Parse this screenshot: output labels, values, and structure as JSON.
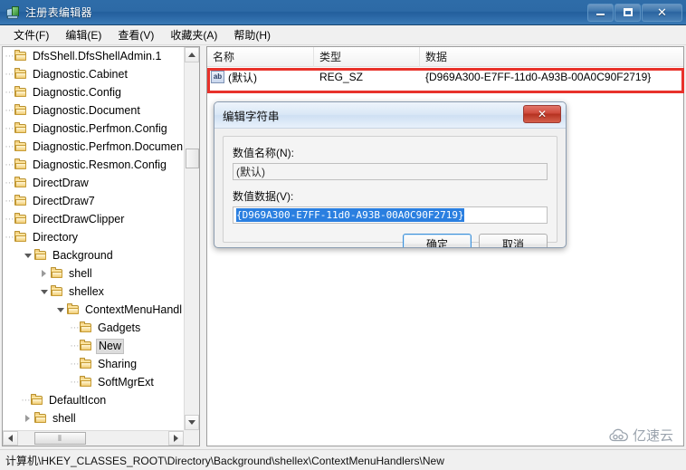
{
  "window": {
    "title": "注册表编辑器",
    "icon": "registry-editor-icon",
    "buttons": {
      "minimize": "minimize-icon",
      "maximize": "maximize-icon",
      "close": "close-icon"
    }
  },
  "menubar": {
    "items": [
      {
        "label": "文件(F)"
      },
      {
        "label": "编辑(E)"
      },
      {
        "label": "查看(V)"
      },
      {
        "label": "收藏夹(A)"
      },
      {
        "label": "帮助(H)"
      }
    ]
  },
  "tree": {
    "items": [
      {
        "label": "DfsShell.DfsShellAdmin.1",
        "indent": 0,
        "twisty": "none",
        "selected": false
      },
      {
        "label": "Diagnostic.Cabinet",
        "indent": 0,
        "twisty": "none",
        "selected": false
      },
      {
        "label": "Diagnostic.Config",
        "indent": 0,
        "twisty": "none",
        "selected": false
      },
      {
        "label": "Diagnostic.Document",
        "indent": 0,
        "twisty": "none",
        "selected": false
      },
      {
        "label": "Diagnostic.Perfmon.Config",
        "indent": 0,
        "twisty": "none",
        "selected": false
      },
      {
        "label": "Diagnostic.Perfmon.Documen",
        "indent": 0,
        "twisty": "none",
        "selected": false
      },
      {
        "label": "Diagnostic.Resmon.Config",
        "indent": 0,
        "twisty": "none",
        "selected": false
      },
      {
        "label": "DirectDraw",
        "indent": 0,
        "twisty": "none",
        "selected": false
      },
      {
        "label": "DirectDraw7",
        "indent": 0,
        "twisty": "none",
        "selected": false
      },
      {
        "label": "DirectDrawClipper",
        "indent": 0,
        "twisty": "none",
        "selected": false
      },
      {
        "label": "Directory",
        "indent": 0,
        "twisty": "none",
        "selected": false
      },
      {
        "label": "Background",
        "indent": 1,
        "twisty": "expanded",
        "selected": false
      },
      {
        "label": "shell",
        "indent": 2,
        "twisty": "collapsed",
        "selected": false
      },
      {
        "label": "shellex",
        "indent": 2,
        "twisty": "expanded",
        "selected": false
      },
      {
        "label": "ContextMenuHandl",
        "indent": 3,
        "twisty": "expanded",
        "selected": false
      },
      {
        "label": "Gadgets",
        "indent": 4,
        "twisty": "none",
        "selected": false
      },
      {
        "label": "New",
        "indent": 4,
        "twisty": "none",
        "selected": true
      },
      {
        "label": "Sharing",
        "indent": 4,
        "twisty": "none",
        "selected": false
      },
      {
        "label": "SoftMgrExt",
        "indent": 4,
        "twisty": "none",
        "selected": false
      },
      {
        "label": "DefaultIcon",
        "indent": 1,
        "twisty": "none",
        "selected": false
      },
      {
        "label": "shell",
        "indent": 1,
        "twisty": "collapsed",
        "selected": false
      }
    ],
    "vertical_scrollbar": {
      "up": "scroll-up-icon",
      "down": "scroll-down-icon"
    },
    "horizontal_scrollbar": {
      "left": "scroll-left-icon",
      "right": "scroll-right-icon",
      "grip": "⦀"
    }
  },
  "list": {
    "columns": [
      {
        "label": "名称"
      },
      {
        "label": "类型"
      },
      {
        "label": "数据"
      }
    ],
    "rows": [
      {
        "icon": "string-value-icon",
        "icon_text": "ab",
        "name": "(默认)",
        "type": "REG_SZ",
        "data": "{D969A300-E7FF-11d0-A93B-00A0C90F2719}",
        "highlighted": true
      }
    ],
    "highlight_color": "#e8322b"
  },
  "dialog": {
    "title": "编辑字符串",
    "close_label": "✕",
    "value_name_label": "数值名称(N):",
    "value_name": "(默认)",
    "value_data_label": "数值数据(V):",
    "value_data": "{D969A300-E7FF-11d0-A93B-00A0C90F2719}",
    "ok_label": "确定",
    "cancel_label": "取消"
  },
  "statusbar": {
    "path": "计算机\\HKEY_CLASSES_ROOT\\Directory\\Background\\shellex\\ContextMenuHandlers\\New"
  },
  "watermark": {
    "text": "亿速云",
    "icon": "cloud-icon"
  }
}
